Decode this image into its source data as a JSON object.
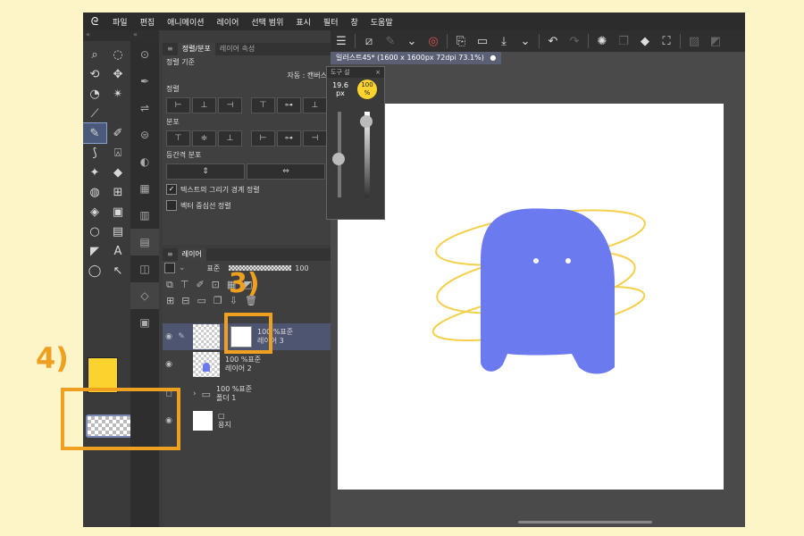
{
  "menu": [
    "파일",
    "편집",
    "애니메이션",
    "레이어",
    "선택 범위",
    "표시",
    "필터",
    "창",
    "도움말"
  ],
  "tool_panel_title": "도",
  "align_panel": {
    "tab1": "정렬/분포",
    "tab2": "레이어 속성",
    "section_basis": "정렬 기준",
    "auto_label": "자동 : 캔버스",
    "section_align": "정렬",
    "section_distribute": "분포",
    "section_equal": "등간격 분포",
    "check_text": "텍스트의 그리기 경계 정렬",
    "check_vector": "벡터 중심선 정렬",
    "check_text_checked": true
  },
  "brush_popup": {
    "title": "도구 설",
    "size": "19.6",
    "size_unit": "px",
    "opacity": "100",
    "opacity_unit": "%"
  },
  "layer_panel": {
    "title": "레이어",
    "blend": "표준",
    "opacity": "100",
    "layers": [
      {
        "line1": "100 %표준",
        "line2": "레이어 3"
      },
      {
        "line1": "100 %표준",
        "line2": "레이어 2"
      },
      {
        "line1": "100 %표준",
        "line2": "폴더 1"
      },
      {
        "line1": "",
        "line2": "용지"
      }
    ]
  },
  "document": {
    "tab": "일러스트45* (1600 x 1600px 72dpi 73.1%)"
  },
  "annotations": {
    "step3": "3)",
    "step4": "4)"
  },
  "colors": {
    "main_color": "#fcd22e",
    "accent": "#f0a020",
    "creature": "#6c7af0",
    "ring": "#f5d04a"
  }
}
